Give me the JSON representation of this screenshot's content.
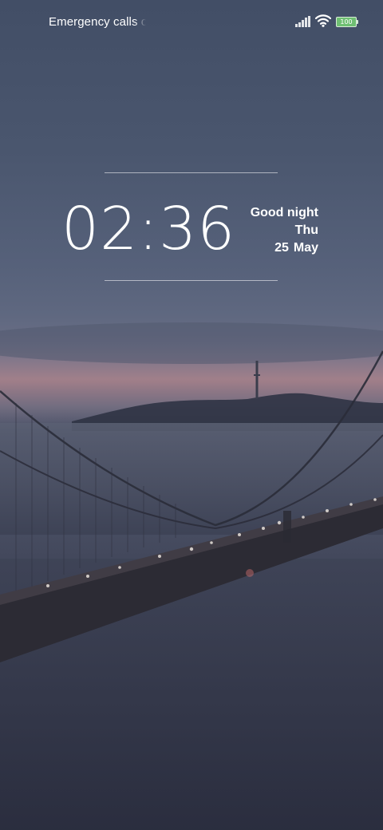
{
  "status_bar": {
    "carrier_text": "Emergency calls only",
    "signal_icon": "signal-bars-icon",
    "wifi_icon": "wifi-icon",
    "battery_level": "100",
    "battery_color": "#6fbf73"
  },
  "lock_screen": {
    "time": "02:36",
    "greeting": "Good night",
    "weekday": "Thu",
    "day": "25",
    "month": "May"
  },
  "wallpaper": {
    "subject": "bridge-over-fog-at-dusk"
  }
}
